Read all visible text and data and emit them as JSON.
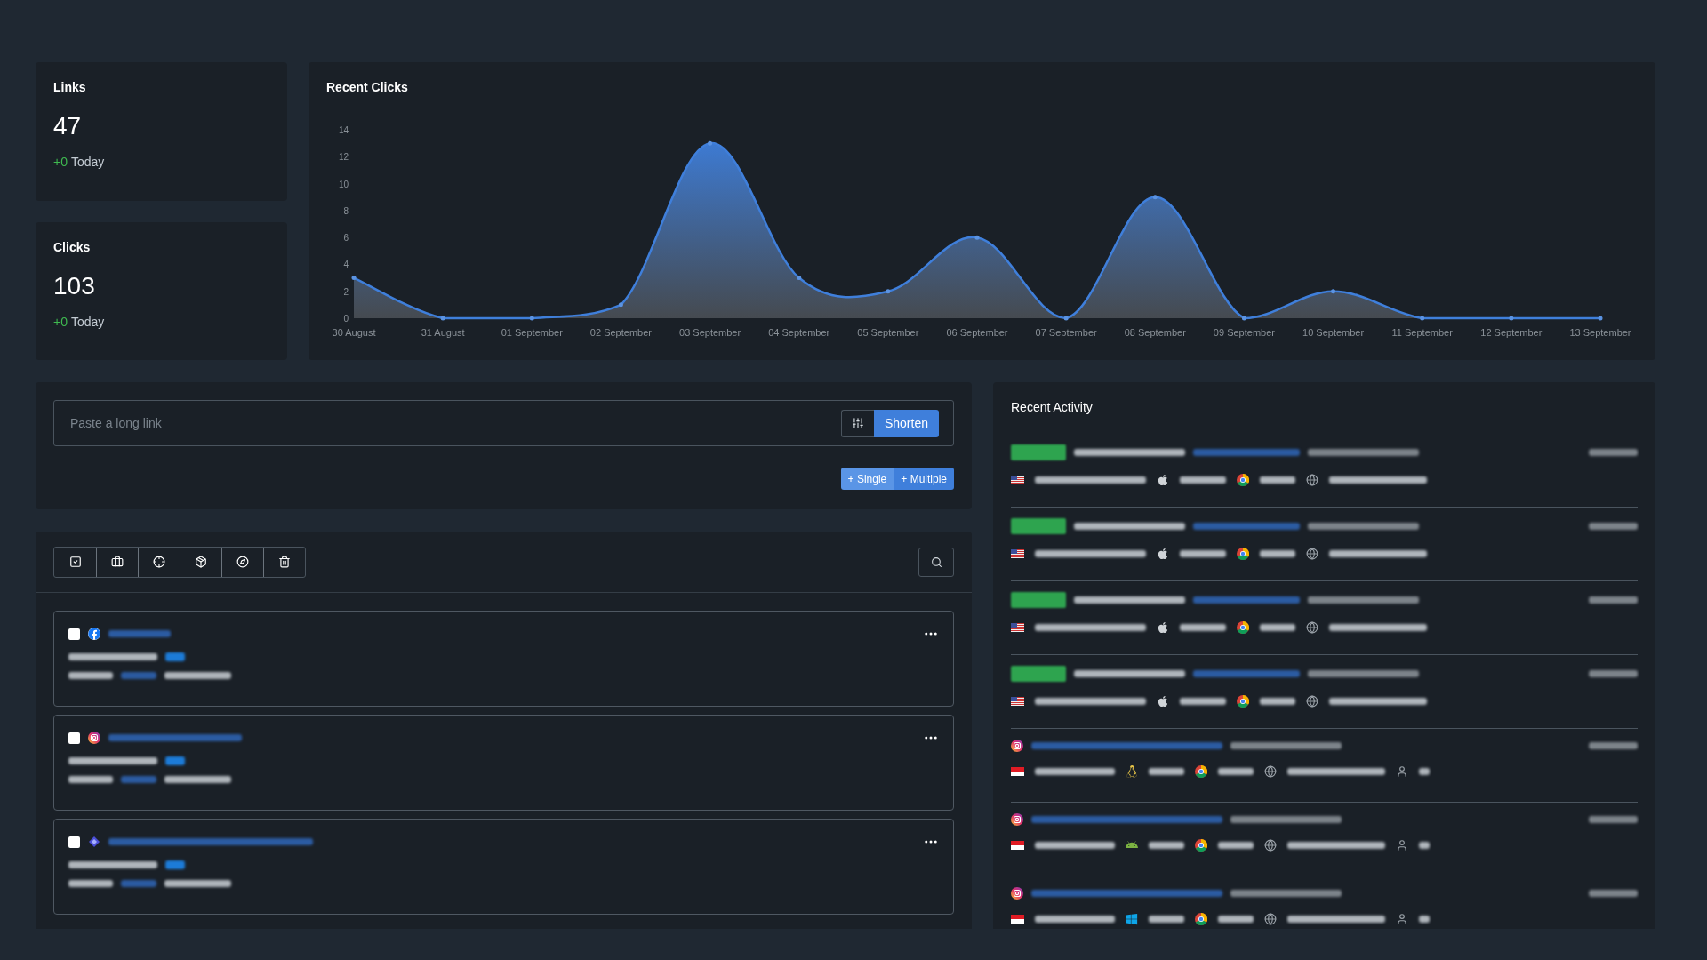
{
  "stats": [
    {
      "label": "Links",
      "value": "47",
      "delta": "+0",
      "delta_label": "Today"
    },
    {
      "label": "Clicks",
      "value": "103",
      "delta": "+0",
      "delta_label": "Today"
    }
  ],
  "chart": {
    "title": "Recent Clicks",
    "chart_data": {
      "type": "area",
      "categories": [
        "30 August",
        "31 August",
        "01 September",
        "02 September",
        "03 September",
        "04 September",
        "05 September",
        "06 September",
        "07 September",
        "08 September",
        "09 September",
        "10 September",
        "11 September",
        "12 September",
        "13 September"
      ],
      "series": [
        {
          "color": "#3f7fdb",
          "values": [
            3,
            0,
            0,
            1,
            13,
            3,
            2,
            6,
            0,
            9,
            0,
            2,
            0,
            0,
            0
          ]
        }
      ],
      "ylim": [
        0,
        14
      ],
      "yticks": [
        0,
        2,
        4,
        6,
        8,
        10,
        12,
        14
      ]
    }
  },
  "shortener": {
    "placeholder": "Paste a long link",
    "shorten": "Shorten",
    "modes": [
      {
        "label": "+ Single",
        "selected": true
      },
      {
        "label": "+ Multiple",
        "selected": false
      }
    ]
  },
  "toolbar": [
    {
      "kind": "check"
    },
    {
      "kind": "briefcase"
    },
    {
      "kind": "crosshair"
    },
    {
      "kind": "box"
    },
    {
      "kind": "compass"
    },
    {
      "kind": "trash"
    }
  ],
  "links": [
    {
      "kind": "facebook",
      "checked": false
    },
    {
      "kind": "instagram",
      "checked": false
    },
    {
      "kind": "diamond",
      "checked": false
    }
  ],
  "activity": {
    "title": "Recent Activity",
    "rows": [
      {
        "kind": "bio",
        "flag": {
          "kind": "us"
        },
        "os": {
          "kind": "mac"
        }
      },
      {
        "kind": "bio",
        "flag": {
          "kind": "us"
        },
        "os": {
          "kind": "mac"
        }
      },
      {
        "kind": "bio",
        "flag": {
          "kind": "us"
        },
        "os": {
          "kind": "mac"
        }
      },
      {
        "kind": "bio",
        "flag": {
          "kind": "us"
        },
        "os": {
          "kind": "mac"
        }
      },
      {
        "kind": "instagram",
        "flag": {
          "kind": "id"
        },
        "os": {
          "kind": "linux"
        }
      },
      {
        "kind": "instagram",
        "flag": {
          "kind": "id"
        },
        "os": {
          "kind": "android"
        }
      },
      {
        "kind": "instagram",
        "flag": {
          "kind": "id"
        },
        "os": {
          "kind": "windows"
        }
      }
    ]
  }
}
